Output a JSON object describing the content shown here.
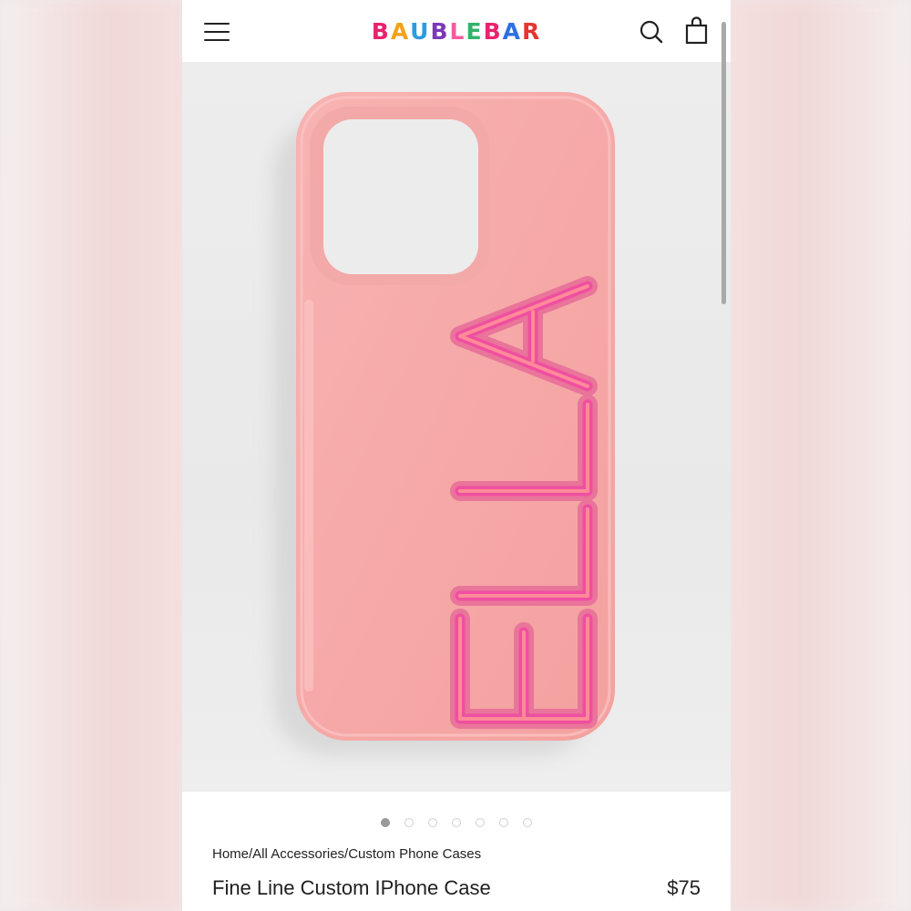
{
  "brand": {
    "name": "BAUBLEBAR",
    "letters": [
      "B",
      "A",
      "U",
      "B",
      "L",
      "E",
      "B",
      "A",
      "R"
    ],
    "letter_colors": [
      "#e8246f",
      "#f3a21c",
      "#2e9be0",
      "#7a3ab8",
      "#f35c9c",
      "#34b36a",
      "#e8246f",
      "#2e6fe0",
      "#e5352f"
    ]
  },
  "header": {
    "menu_icon": "hamburger-menu-icon",
    "search_icon": "search-icon",
    "bag_icon": "shopping-bag-icon"
  },
  "product": {
    "case_color": "#f7aaa9",
    "letters_color": "#f04fa0",
    "custom_text": "ELLA"
  },
  "carousel": {
    "total": 7,
    "active": 1
  },
  "breadcrumb": "Home/All Accessories/Custom Phone Cases",
  "title": "Fine Line Custom IPhone Case",
  "price": "$75"
}
